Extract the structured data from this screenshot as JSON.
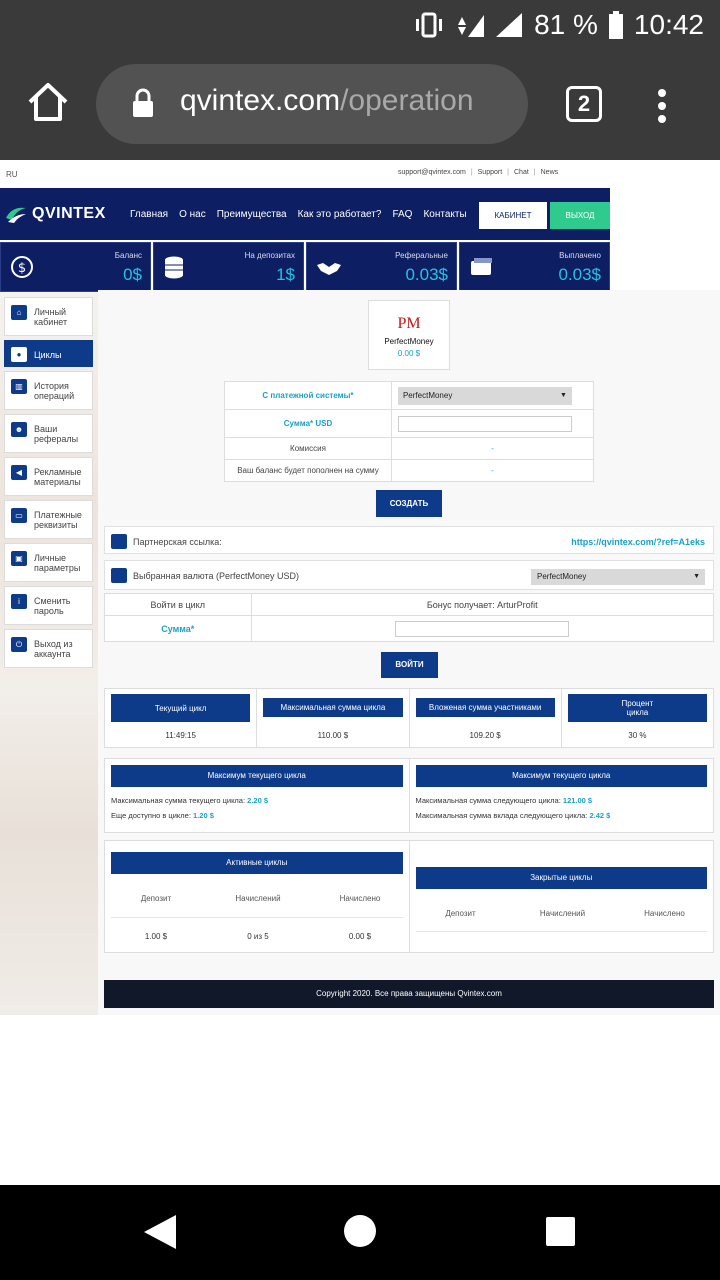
{
  "status_bar": {
    "battery": "81 %",
    "time": "10:42",
    "network": "4G"
  },
  "browser": {
    "url_domain": "qvintex.com",
    "url_path": "/operation",
    "tab_count": "2"
  },
  "site": {
    "lang": "RU",
    "top_links": [
      "support@qvintex.com",
      "Support",
      "Chat",
      "News"
    ],
    "logo_text": "QVINTEX",
    "nav": [
      "Главная",
      "О нас",
      "Преимущества",
      "Как это работает?",
      "FAQ",
      "Контакты"
    ],
    "cabinet_btn": "КАБИНЕТ",
    "exit_btn": "ВЫХОД",
    "stats": [
      {
        "label": "Баланс",
        "value": "0$"
      },
      {
        "label": "На депозитах",
        "value": "1$"
      },
      {
        "label": "Реферальные",
        "value": "0.03$"
      },
      {
        "label": "Выплачено",
        "value": "0.03$"
      }
    ]
  },
  "sidebar": [
    {
      "label": "Личный кабинет",
      "active": false
    },
    {
      "label": "Циклы",
      "active": true
    },
    {
      "label": "История операций",
      "active": false
    },
    {
      "label": "Ваши рефералы",
      "active": false
    },
    {
      "label": "Рекламные материалы",
      "active": false
    },
    {
      "label": "Платежные реквизиты",
      "active": false
    },
    {
      "label": "Личные параметры",
      "active": false
    },
    {
      "label": "Сменить пароль",
      "active": false
    },
    {
      "label": "Выход из аккаунта",
      "active": false
    }
  ],
  "payment": {
    "pm_logo": "PM",
    "pm_name": "PerfectMoney",
    "pm_amount": "0.00 $",
    "from_label": "С платежной системы*",
    "from_value": "PerfectMoney",
    "sum_label": "Сумма* USD",
    "commission_label": "Комиссия",
    "commission_value": "-",
    "balance_label": "Ваш баланс будет пополнен на сумму",
    "balance_value": "-",
    "create_btn": "СОЗДАТЬ"
  },
  "partner": {
    "label": "Партнерская ссылка:",
    "link": "https://qvintex.com/?ref=A1eks"
  },
  "currency": {
    "label": "Выбранная валюта (PerfectMoney USD)",
    "value": "PerfectMoney"
  },
  "cycle_join": {
    "join_label": "Войти в цикл",
    "bonus_label": "Бонус получает: ArturProfit",
    "sum_label": "Сумма*",
    "enter_btn": "ВОЙТИ"
  },
  "cycle_stats": [
    {
      "header": "Текущий цикл",
      "value": "11:49:15"
    },
    {
      "header": "Максимальная сумма цикла",
      "value": "110.00 $"
    },
    {
      "header": "Вложеная сумма участниками",
      "value": "109.20 $"
    },
    {
      "header": "Процент цикла",
      "value": "30 %"
    }
  ],
  "max_current": {
    "header": "Максимум текущего цикла",
    "line1_label": "Максимальная сумма текущего цикла:",
    "line1_value": "2.20 $",
    "line2_label": "Еще доступно в цикле:",
    "line2_value": "1.20 $"
  },
  "max_next": {
    "header": "Максимум текущего цикла",
    "line1_label": "Максимальная сумма следующего цикла:",
    "line1_value": "121.00 $",
    "line2_label": "Максимальная сумма вклада следующего цикла:",
    "line2_value": "2.42 $"
  },
  "active_cycles": {
    "header": "Активные циклы",
    "columns": [
      "Депозит",
      "Начислений",
      "Начислено"
    ],
    "row": [
      "1.00 $",
      "0 из 5",
      "0.00 $"
    ]
  },
  "closed_cycles": {
    "header": "Закрытые циклы",
    "columns": [
      "Депозит",
      "Начислений",
      "Начислено"
    ]
  },
  "footer": "Copyright 2020. Все права защищены Qvintex.com"
}
